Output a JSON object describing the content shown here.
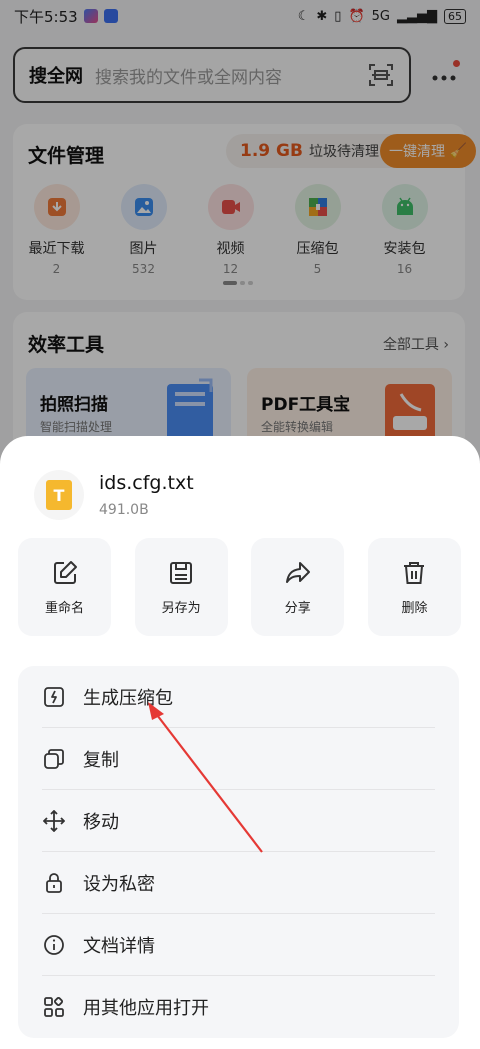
{
  "status_bar": {
    "time": "下午5:53",
    "network": "5G",
    "battery": "65"
  },
  "search": {
    "title": "搜全网",
    "placeholder": "搜索我的文件或全网内容"
  },
  "file_management": {
    "title": "文件管理",
    "junk_size": "1.9 GB",
    "junk_label": "垃圾待清理",
    "clean_button": "一键清理",
    "categories": [
      {
        "name": "最近下载",
        "count": "2",
        "icon": "download-icon",
        "color": "#f07a3a"
      },
      {
        "name": "图片",
        "count": "532",
        "icon": "image-icon",
        "color": "#3b8ef0"
      },
      {
        "name": "视频",
        "count": "12",
        "icon": "video-icon",
        "color": "#e8504a"
      },
      {
        "name": "压缩包",
        "count": "5",
        "icon": "archive-icon",
        "color": "#4caf50"
      },
      {
        "name": "安装包",
        "count": "16",
        "icon": "android-icon",
        "color": "#3fbf6a"
      }
    ]
  },
  "efficiency_tools": {
    "title": "效率工具",
    "all_tools": "全部工具",
    "tools": [
      {
        "name": "拍照扫描",
        "subtitle": "智能扫描处理"
      },
      {
        "name": "PDF工具宝",
        "subtitle": "全能转换编辑"
      }
    ]
  },
  "sheet": {
    "file_name": "ids.cfg.txt",
    "file_size": "491.0B",
    "file_icon_letter": "T",
    "actions": [
      {
        "label": "重命名",
        "icon": "edit-icon"
      },
      {
        "label": "另存为",
        "icon": "save-icon"
      },
      {
        "label": "分享",
        "icon": "share-icon"
      },
      {
        "label": "删除",
        "icon": "trash-icon"
      }
    ],
    "menu": [
      {
        "label": "生成压缩包",
        "icon": "zip-icon"
      },
      {
        "label": "复制",
        "icon": "copy-icon"
      },
      {
        "label": "移动",
        "icon": "move-icon"
      },
      {
        "label": "设为私密",
        "icon": "lock-icon"
      },
      {
        "label": "文档详情",
        "icon": "info-icon"
      },
      {
        "label": "用其他应用打开",
        "icon": "apps-icon"
      }
    ]
  },
  "colors": {
    "accent_orange": "#f08c2a",
    "annotation_arrow": "#e53935"
  }
}
